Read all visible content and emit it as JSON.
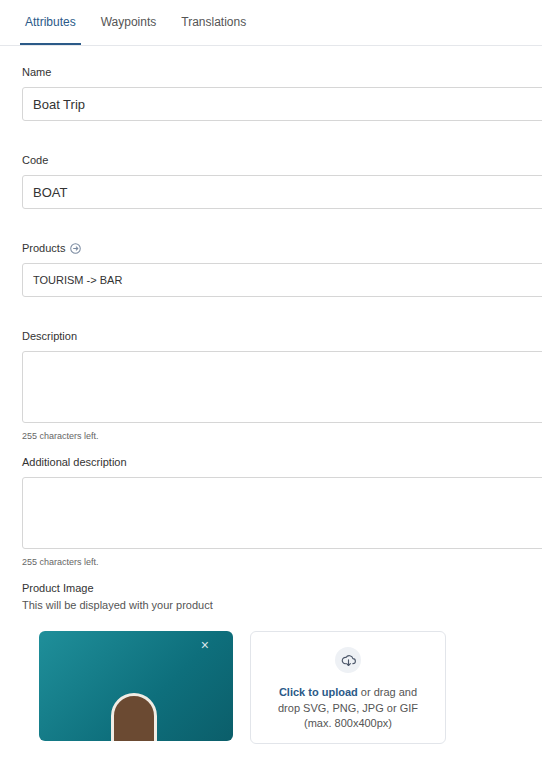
{
  "tabs": [
    {
      "label": "Attributes",
      "selected": true
    },
    {
      "label": "Waypoints",
      "selected": false
    },
    {
      "label": "Translations",
      "selected": false
    }
  ],
  "fields": [
    {
      "kind": "input",
      "label": "Name",
      "value": "Boat Trip"
    },
    {
      "kind": "input",
      "label": "Code",
      "value": "BOAT"
    },
    {
      "kind": "select",
      "label": "Products",
      "value": "TOURISM -> BAR"
    },
    {
      "kind": "textarea",
      "label": "Description",
      "value": "",
      "counter": "255 characters left."
    },
    {
      "kind": "textarea",
      "label": "Additional description",
      "value": "",
      "counter": "255 characters left."
    }
  ],
  "image": {
    "label": "Product Image",
    "hint": "This will be displayed with your product",
    "remove": "×",
    "upload": {
      "link": "Click to upload",
      "text": " or drag and drop SVG, PNG, JPG or GIF (max. 800x400px)"
    }
  }
}
